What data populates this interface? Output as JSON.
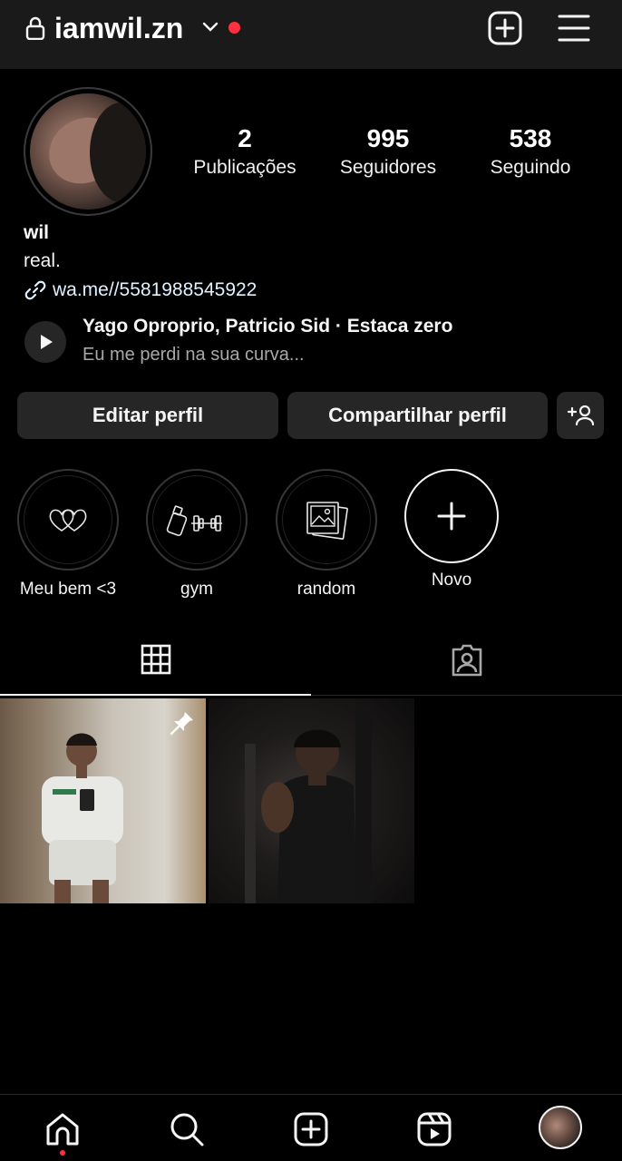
{
  "header": {
    "username": "iamwil.zn",
    "icons": [
      "lock-icon",
      "chevron-down-icon",
      "notification-dot",
      "new-post-icon",
      "menu-icon"
    ]
  },
  "profile": {
    "stats": [
      {
        "value": "2",
        "label": "Publicações"
      },
      {
        "value": "995",
        "label": "Seguidores"
      },
      {
        "value": "538",
        "label": "Seguindo"
      }
    ],
    "name": "wil",
    "bio": "real.",
    "link": "wa.me//5581988545922",
    "music": {
      "title": "Yago Oproprio, Patricio Sid · Estaca zero",
      "subtitle": "Eu me perdi na sua curva..."
    }
  },
  "actions": {
    "edit": "Editar perfil",
    "share": "Compartilhar perfil"
  },
  "highlights": [
    {
      "label": "Meu bem <3",
      "icon": "hearts-icon"
    },
    {
      "label": "gym",
      "icon": "dumbbell-icon"
    },
    {
      "label": "random",
      "icon": "photos-icon"
    },
    {
      "label": "Novo",
      "icon": "plus-icon"
    }
  ],
  "tabs": [
    {
      "name": "grid",
      "active": true
    },
    {
      "name": "tagged",
      "active": false
    }
  ],
  "posts": [
    {
      "pinned": true
    },
    {
      "pinned": false
    }
  ],
  "bottom_nav": [
    "home-icon",
    "search-icon",
    "create-icon",
    "reels-icon",
    "profile-avatar"
  ],
  "colors": {
    "background": "#000000",
    "surface": "#262626",
    "topbar": "#1a1a1a",
    "accent_red": "#ff3040",
    "link": "#e0f1ff"
  }
}
